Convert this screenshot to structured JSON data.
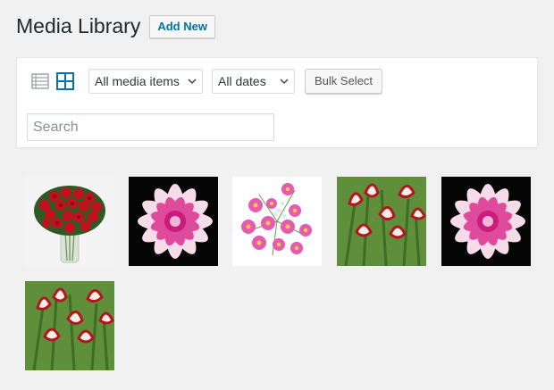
{
  "header": {
    "title": "Media Library",
    "add_new_label": "Add New"
  },
  "toolbar": {
    "list_view_icon": "list-view-icon",
    "grid_view_icon": "grid-view-icon",
    "media_filter": {
      "selected": "All media items"
    },
    "date_filter": {
      "selected": "All dates"
    },
    "bulk_select_label": "Bulk Select",
    "search": {
      "placeholder": "Search",
      "value": ""
    }
  },
  "colors": {
    "accent": "#0073aa",
    "grid_icon_active": "#0073aa",
    "list_icon_inactive": "#a0a5aa",
    "background": "#f1f1f1"
  },
  "attachments": [
    {
      "subject": "red roses bouquet in glass vase"
    },
    {
      "subject": "pink and white dahlia on black"
    },
    {
      "subject": "pink daisy flowers on white"
    },
    {
      "subject": "red and white striped lilies"
    },
    {
      "subject": "pink and white dahlia on black"
    },
    {
      "subject": "red and white striped lilies"
    }
  ]
}
